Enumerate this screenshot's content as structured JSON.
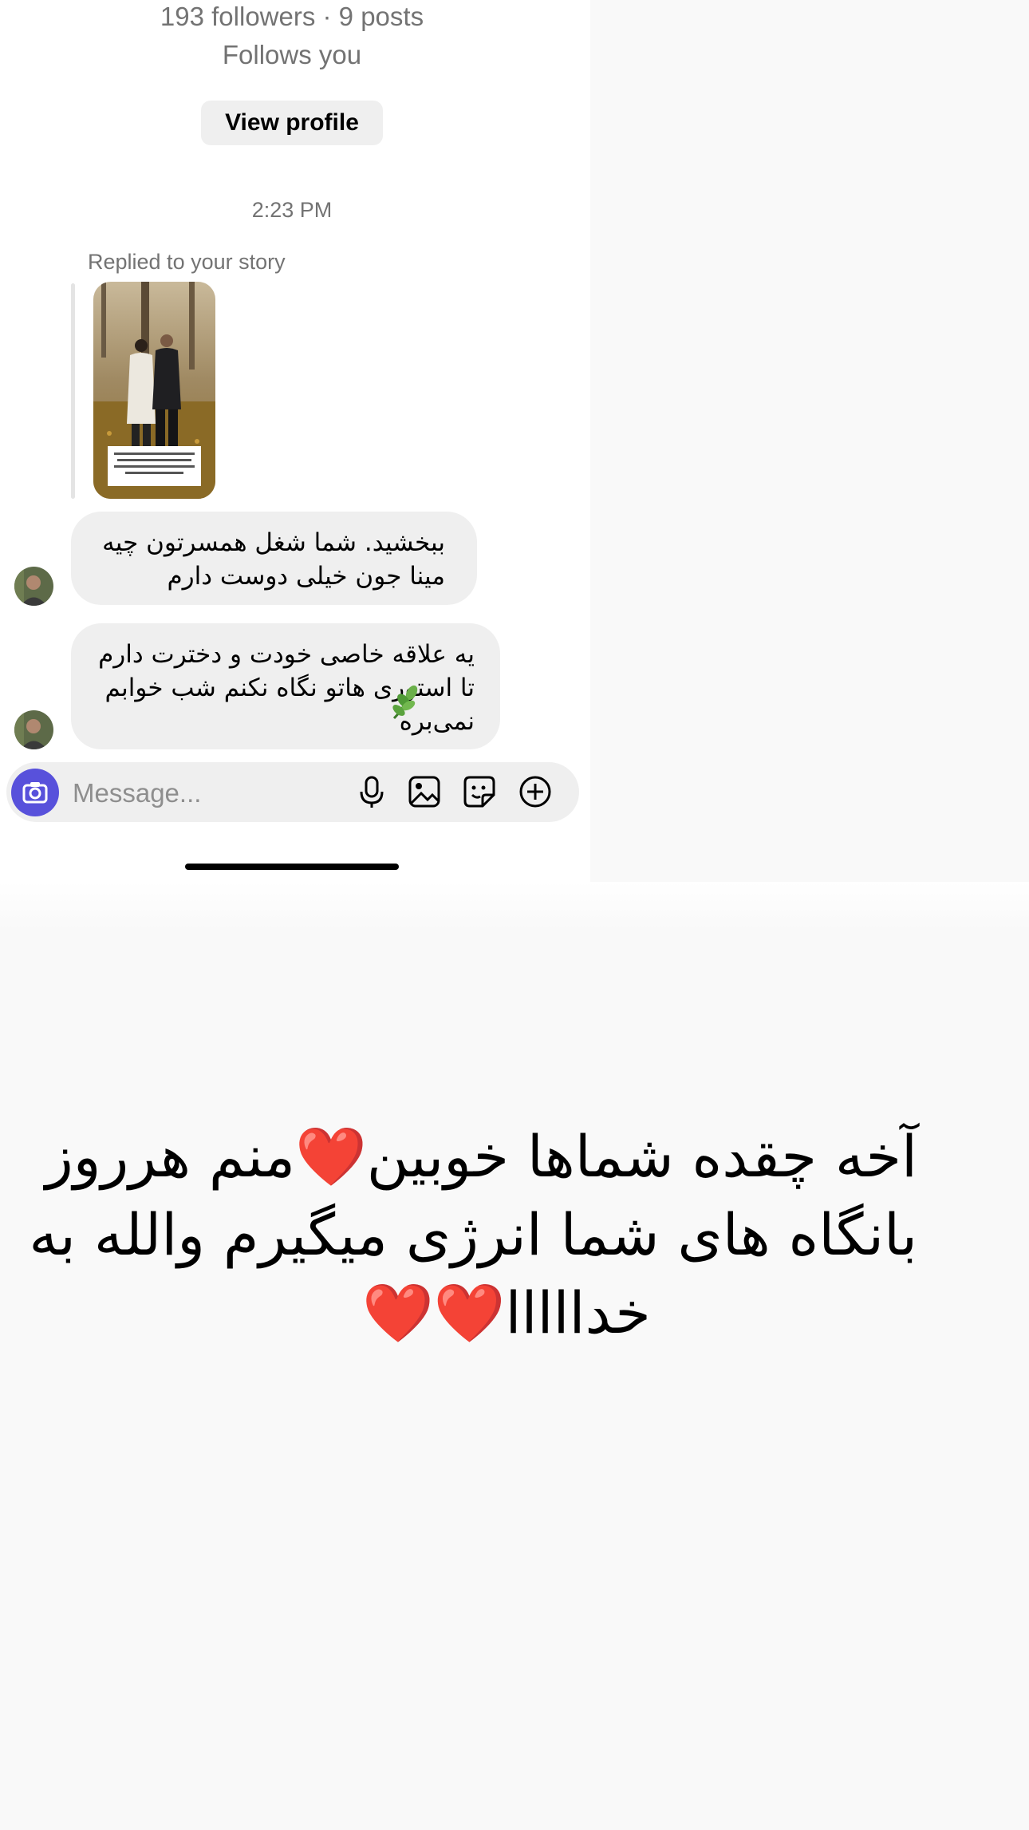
{
  "profile": {
    "stats": "193 followers · 9 posts",
    "follows_you": "Follows you",
    "view_profile_label": "View profile"
  },
  "conversation": {
    "timestamp": "2:23 PM",
    "story_reply_label": "Replied to your story",
    "story_caption": "همیشه از دیدن مینا جون تصویرشون تمام شده لذت میبرم",
    "messages": [
      {
        "lines": [
          "ببخشید. شما شغل همسرتون چیه",
          "مینا جون خیلی دوست دارم"
        ]
      },
      {
        "lines": [
          "یه علاقه خاصی خودت و دخترت دارم",
          "تا استوری هاتو نگاه نکنم شب خوابم",
          "نمی‌بره"
        ],
        "emoji": "herb"
      }
    ]
  },
  "composer": {
    "placeholder": "Message...",
    "icons": [
      "camera-icon",
      "microphone-icon",
      "gallery-icon",
      "sticker-icon",
      "add-icon"
    ],
    "accent_color": "#5851db"
  },
  "overlay": {
    "lines": [
      "آخه چقده شماها خوبین❤️منم هرروز",
      "بانگاه های شما انرژی میگیرم والله به",
      "خدااااا❤️❤️"
    ]
  }
}
